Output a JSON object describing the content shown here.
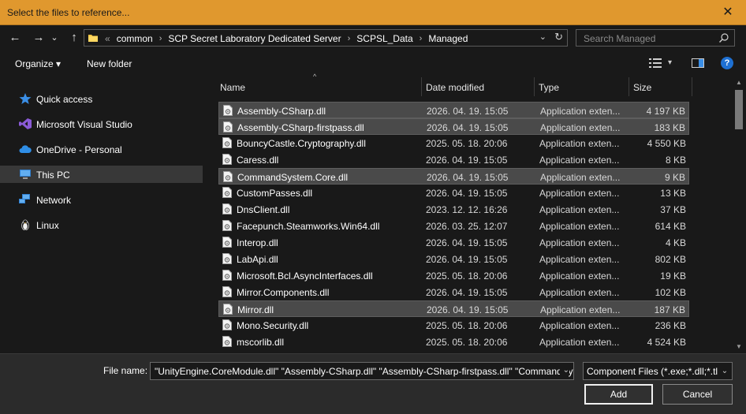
{
  "window": {
    "title": "Select the files to reference...",
    "close_glyph": "✕"
  },
  "nav": {
    "back_glyph": "←",
    "forward_glyph": "→",
    "recent_glyph": "⌄",
    "up_glyph": "↑"
  },
  "address": {
    "overflow": "«",
    "crumbs": [
      "common",
      "SCP Secret Laboratory Dedicated Server",
      "SCPSL_Data",
      "Managed"
    ],
    "separator": "›",
    "dropdown_glyph": "⌄",
    "refresh_glyph": "↻"
  },
  "search": {
    "placeholder": "Search Managed"
  },
  "toolbar": {
    "organize_label": "Organize ▾",
    "new_folder_label": "New folder",
    "view_dropdown_glyph": "▾",
    "help_glyph": "?"
  },
  "sidebar": {
    "items": [
      {
        "label": "Quick access",
        "icon": "star-icon"
      },
      {
        "label": "Microsoft Visual Studio",
        "icon": "visual-studio-icon"
      },
      {
        "label": "OneDrive - Personal",
        "icon": "cloud-icon"
      },
      {
        "label": "This PC",
        "icon": "computer-icon",
        "selected": true
      },
      {
        "label": "Network",
        "icon": "network-icon"
      },
      {
        "label": "Linux",
        "icon": "penguin-icon"
      }
    ]
  },
  "columns": {
    "name": "Name",
    "date": "Date modified",
    "type": "Type",
    "size": "Size",
    "sort_glyph": "^"
  },
  "files": [
    {
      "name": "Assembly-CSharp.dll",
      "date": "2026. 04. 19. 15:05",
      "type": "Application exten...",
      "size": "4 197 KB",
      "selected": true
    },
    {
      "name": "Assembly-CSharp-firstpass.dll",
      "date": "2026. 04. 19. 15:05",
      "type": "Application exten...",
      "size": "183 KB",
      "selected": true
    },
    {
      "name": "BouncyCastle.Cryptography.dll",
      "date": "2025. 05. 18. 20:06",
      "type": "Application exten...",
      "size": "4 550 KB",
      "selected": false
    },
    {
      "name": "Caress.dll",
      "date": "2026. 04. 19. 15:05",
      "type": "Application exten...",
      "size": "8 KB",
      "selected": false
    },
    {
      "name": "CommandSystem.Core.dll",
      "date": "2026. 04. 19. 15:05",
      "type": "Application exten...",
      "size": "9 KB",
      "selected": true
    },
    {
      "name": "CustomPasses.dll",
      "date": "2026. 04. 19. 15:05",
      "type": "Application exten...",
      "size": "13 KB",
      "selected": false
    },
    {
      "name": "DnsClient.dll",
      "date": "2023. 12. 12. 16:26",
      "type": "Application exten...",
      "size": "37 KB",
      "selected": false
    },
    {
      "name": "Facepunch.Steamworks.Win64.dll",
      "date": "2026. 03. 25. 12:07",
      "type": "Application exten...",
      "size": "614 KB",
      "selected": false
    },
    {
      "name": "Interop.dll",
      "date": "2026. 04. 19. 15:05",
      "type": "Application exten...",
      "size": "4 KB",
      "selected": false
    },
    {
      "name": "LabApi.dll",
      "date": "2026. 04. 19. 15:05",
      "type": "Application exten...",
      "size": "802 KB",
      "selected": false
    },
    {
      "name": "Microsoft.Bcl.AsyncInterfaces.dll",
      "date": "2025. 05. 18. 20:06",
      "type": "Application exten...",
      "size": "19 KB",
      "selected": false
    },
    {
      "name": "Mirror.Components.dll",
      "date": "2026. 04. 19. 15:05",
      "type": "Application exten...",
      "size": "102 KB",
      "selected": false
    },
    {
      "name": "Mirror.dll",
      "date": "2026. 04. 19. 15:05",
      "type": "Application exten...",
      "size": "187 KB",
      "selected": true
    },
    {
      "name": "Mono.Security.dll",
      "date": "2025. 05. 18. 20:06",
      "type": "Application exten...",
      "size": "236 KB",
      "selected": false
    },
    {
      "name": "mscorlib.dll",
      "date": "2025. 05. 18. 20:06",
      "type": "Application exten...",
      "size": "4 524 KB",
      "selected": false
    }
  ],
  "scroll": {
    "up_glyph": "▲",
    "down_glyph": "▼"
  },
  "footer": {
    "file_name_label": "File name:",
    "file_name_value": "\"UnityEngine.CoreModule.dll\" \"Assembly-CSharp.dll\" \"Assembly-CSharp-firstpass.dll\" \"CommandSystem.Core.dll\" \"Mirror.dll\"",
    "file_name_dropdown_glyph": "⌄",
    "filter_value": "Component Files (*.exe;*.dll;*.tlb;*.olb;*.ocx)",
    "filter_dropdown_glyph": "⌄",
    "add_label": "Add",
    "cancel_label": "Cancel"
  },
  "colors": {
    "titlebar": "#e0982e",
    "background": "#191919",
    "selection": "#4a4a4a",
    "footer": "#2b2b2b"
  }
}
